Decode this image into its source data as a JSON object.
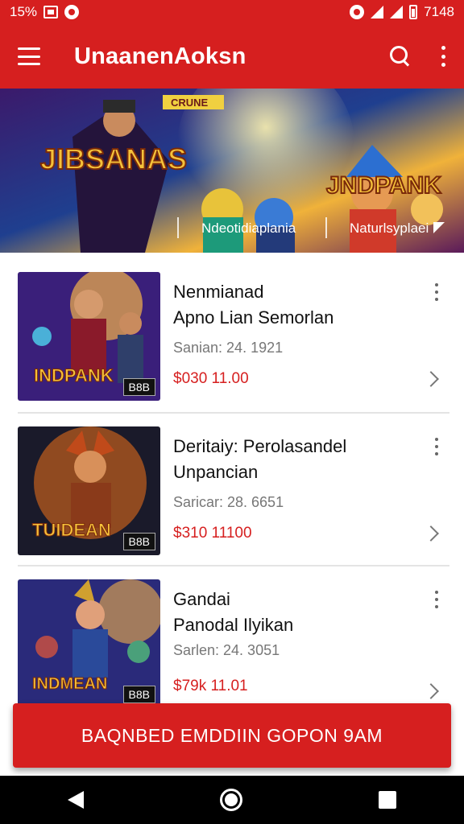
{
  "status": {
    "left_text": "15%",
    "time": "7148"
  },
  "appbar": {
    "title": "UnaanenAoksn"
  },
  "banner": {
    "art_titles": [
      "JIBSANAS",
      "JNDPANK"
    ],
    "tag_left": "CRUNE",
    "caption_left": "Ndeotidiaplania",
    "caption_right": "Naturlsyplaei"
  },
  "items": [
    {
      "title": "Nenmianad",
      "subtitle": "Apno Lian Semorlan",
      "meta": "Sanian: 24. 1921",
      "price": "$030   11.00",
      "badge": "B8B",
      "art_text": "INDPANK"
    },
    {
      "title": "Deritaiy: Perolasandel",
      "subtitle": "Unpancian",
      "meta": "Saricar: 28. 6651",
      "price": "$310   11100",
      "badge": "B8B",
      "art_text": "TUIDEAN"
    },
    {
      "title": "Gandai",
      "subtitle": "Panodal Ilyikan",
      "meta": "Sarlen: 24. 3051",
      "price": "$79k   11.01",
      "badge": "B8B",
      "art_text": "INDMEAN"
    }
  ],
  "cta": {
    "label": "BAQNBED EMDDIIN GOPON 9AM"
  },
  "colors": {
    "brand": "#d61f1f",
    "nav": "#000000"
  }
}
